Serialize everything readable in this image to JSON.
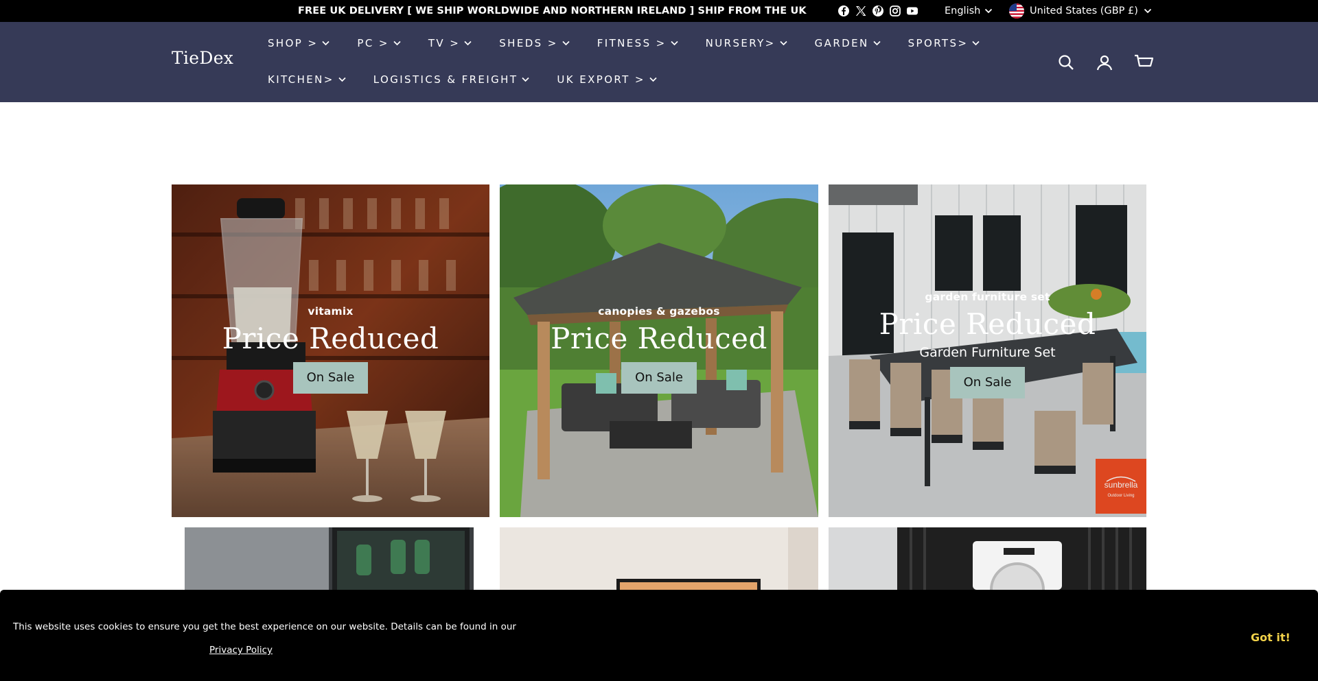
{
  "announcement": {
    "text": "FREE UK DELIVERY [ WE SHIP WORLDWIDE AND NORTHERN IRELAND ] SHIP FROM THE UK",
    "social_icons": [
      "facebook-icon",
      "x-icon",
      "pinterest-icon",
      "instagram-icon",
      "youtube-icon"
    ],
    "language": "English",
    "currency": "United States (GBP £)"
  },
  "header": {
    "logo": "TieDex",
    "nav_row1": [
      "SHOP >",
      "PC >",
      "TV >",
      "SHEDS >",
      "FITNESS >",
      "NURSERY>",
      "GARDEN",
      "SPORTS>"
    ],
    "nav_row2": [
      "KITCHEN>",
      "LOGISTICS & FREIGHT",
      "UK EXPORT >"
    ],
    "icons": [
      "search-icon",
      "account-icon",
      "cart-icon"
    ]
  },
  "tiles": [
    {
      "subtitle": "vitamix",
      "title": "Price Reduced",
      "description": "",
      "button": "On Sale"
    },
    {
      "subtitle": "canopies & gazebos",
      "title": "Price Reduced",
      "description": "",
      "button": "On Sale"
    },
    {
      "subtitle": "garden furniture set",
      "title": "Price Reduced",
      "description": "Garden Furniture Set",
      "button": "On Sale",
      "badge": "sunbrella",
      "badge_sub": "Outdoor Living"
    }
  ],
  "cookie": {
    "text": "This website uses cookies to ensure you get the best experience on our website. Details can be found in our",
    "link": "Privacy Policy",
    "button": "Got it!"
  },
  "colors": {
    "header_bg": "#363a57",
    "announcement_bg": "#000000",
    "button_bg": "#a8c4bd",
    "cookie_button": "#f2d24a"
  }
}
